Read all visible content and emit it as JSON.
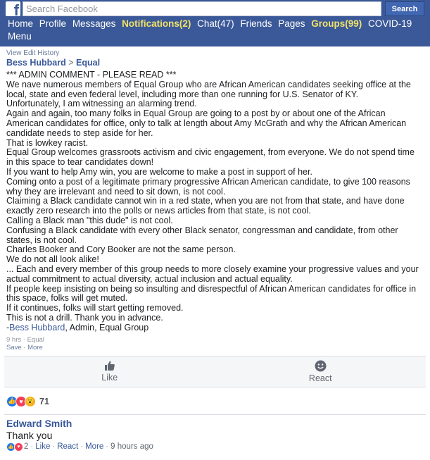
{
  "header": {
    "logo": "f",
    "search_placeholder": "Search Facebook",
    "search_button": "Search",
    "nav": [
      {
        "label": "Home",
        "highlight": false
      },
      {
        "label": "Profile",
        "highlight": false
      },
      {
        "label": "Messages",
        "highlight": false
      },
      {
        "label": "Notifications(2)",
        "highlight": true
      },
      {
        "label": "Chat(47)",
        "highlight": false
      },
      {
        "label": "Friends",
        "highlight": false
      },
      {
        "label": "Pages",
        "highlight": false
      },
      {
        "label": "Groups(99)",
        "highlight": true
      },
      {
        "label": "COVID-19",
        "highlight": false
      },
      {
        "label": "Menu",
        "highlight": false
      }
    ]
  },
  "post": {
    "edit_history": "View Edit History",
    "author": "Bess Hubbard",
    "separator": ">",
    "group": "Equal",
    "body_lines": [
      "*** ADMIN COMMENT - PLEASE READ ***",
      "We nave numerous members of Equal Group who are African American candidates seeking office at the local, state and even federal level, including more than one running for U.S. Senator of KY.",
      "Unfortunately, I am witnessing an alarming trend.",
      "Again and again, too many folks in Equal Group are going to a post by or about one of the African American candidates for office, only to talk at length about Amy McGrath and why the African American candidate needs to step aside for her.",
      "That is lowkey racist.",
      "Equal Group welcomes grassroots activism and civic engagement, from everyone. We do not spend time in this space to tear candidates down!",
      "If you want to help Amy win, you are welcome to make a post in support of her.",
      "Coming onto a post of a legitimate primary progressive African American candidate, to give 100 reasons why they are irrelevant and need to sit down, is not cool.",
      "Claiming a Black candidate cannot win in a red state, when you are not from that state, and have done exactly zero research into the polls or news articles from that state, is not cool.",
      "Calling a Black man \"this dude\" is not cool.",
      "Confusing a Black candidate with every other Black senator, congressman and candidate, from other states, is not cool.",
      "Charles Booker and Cory Booker are not the same person.",
      "We do not all look alike!",
      "... Each and every member of this group needs to more closely examine your progressive values and your actual commitment to actual diversity, actual inclusion and actual equality.",
      "If people keep insisting on being so insulting and disrespectful of African American candidates for office in this space, folks will get muted.",
      "If it continues, folks will start getting removed.",
      "This is not a drill. Thank you in advance."
    ],
    "signature_prefix": "-",
    "signature_name": "Bess Hubbard",
    "signature_suffix": ", Admin, Equal Group",
    "meta_time": "9 hrs",
    "meta_dot": "·",
    "meta_group": "Equal",
    "meta_save": "Save",
    "meta_more": "More"
  },
  "actions": {
    "like": "Like",
    "react": "React"
  },
  "reactions": {
    "count": "71",
    "icons": [
      "like-icon",
      "love-icon",
      "wow-icon"
    ]
  },
  "comment": {
    "author": "Edward Smith",
    "text": "Thank you",
    "reaction_count": "2",
    "like": "Like",
    "react": "React",
    "more": "More",
    "time": "9 hours ago",
    "dot": "·"
  },
  "colors": {
    "header_bg": "#3b5998",
    "highlight": "#f1e26a",
    "link": "#385898",
    "like_blue": "#1877f2",
    "love_red": "#f33e58",
    "wow_yellow": "#f7b125"
  }
}
